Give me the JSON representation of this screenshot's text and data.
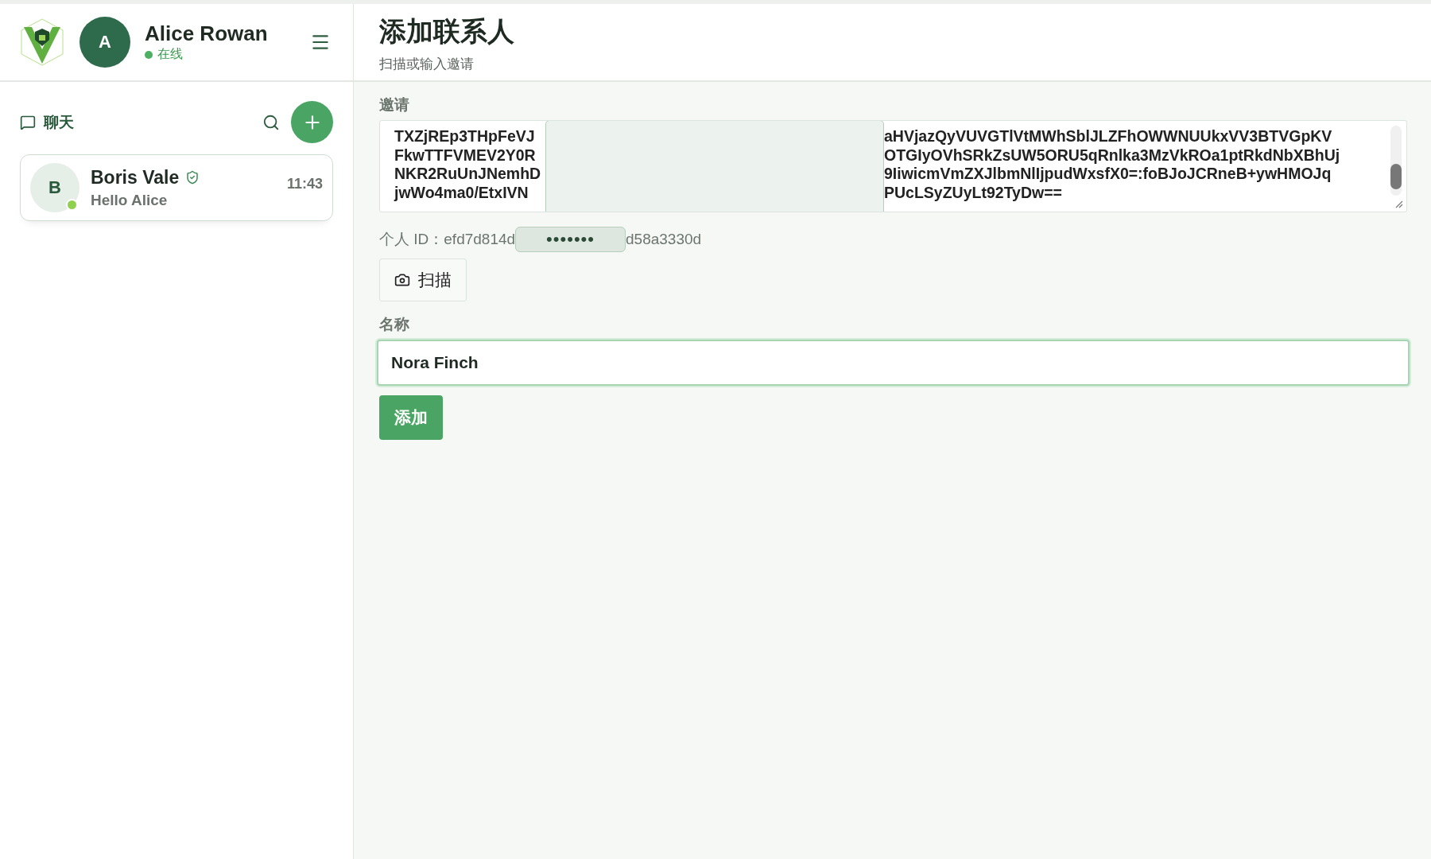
{
  "user": {
    "name": "Alice Rowan",
    "avatar": "A",
    "status": "在线",
    "online": true
  },
  "sidebar": {
    "section": "聊天",
    "chats": [
      {
        "avatar": "B",
        "name": "Boris Vale",
        "verified": true,
        "online": true,
        "preview": "Hello Alice",
        "time": "11:43",
        "selected": false
      }
    ]
  },
  "page": {
    "title": "添加联系人",
    "subtitle": "扫描或输入邀请"
  },
  "invite": {
    "label": "邀请",
    "lines_left": [
      "TXZjREp3THpFeVJ",
      "FkwTTFVMEV2Y0R",
      "NKR2RuUnJNemhD",
      "jwWo4ma0/EtxIVN"
    ],
    "lines_right": [
      "aHVjazQyVUVGTlVtMWhSblJLZFhOWWNUUkxVV3BTVGpKV",
      "OTGIyOVhSRkZsUW5ORU5qRnlka3MzVkROa1ptRkdNbXBhUj",
      "9IiwicmVmZXJlbmNlIjpudWxsfX0=:foBJoJCRneB+ywHMOJq",
      "PUcLSyZUyLt92TyDw=="
    ]
  },
  "personal_id": {
    "label": "个人 ID：",
    "start": "efd7d814d",
    "masked": "•••••••",
    "end": "d58a3330d"
  },
  "scan_button": "扫描",
  "name_field": {
    "label": "名称",
    "value": "Nora Finch",
    "focused": true
  },
  "add_button": "添加"
}
